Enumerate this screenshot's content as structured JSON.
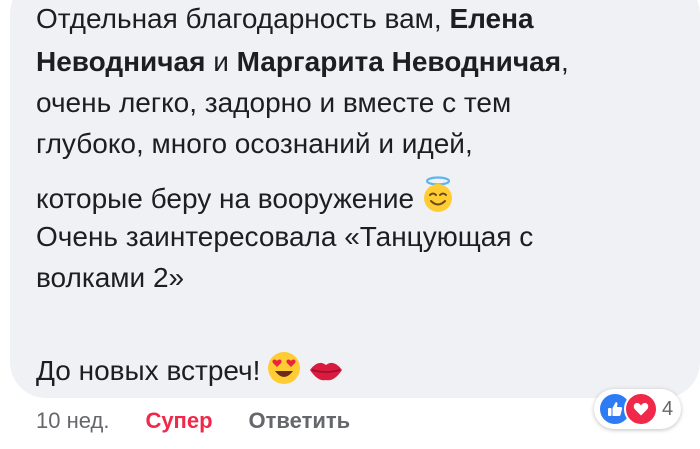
{
  "comment": {
    "line1": {
      "text": "Отдельная благодарность вам, ",
      "bold": "Елена"
    },
    "line2": {
      "bold1": "Неводничая",
      "mid": " и ",
      "bold2": "Маргарита Неводничая",
      "end": ","
    },
    "line3": "очень легко, задорно и вместе с тем",
    "line4": "глубоко, много осознаний и идей,",
    "line5": "которые беру на вооружение",
    "line6": "Очень заинтересовала «Танцующая с",
    "line7": "волками 2»",
    "line8": "До новых встреч!",
    "emojis": [
      "smiling-face-with-halo",
      "smiling-face-with-heart-eyes",
      "kiss-mark"
    ]
  },
  "footer": {
    "timestamp": "10 нед.",
    "like_label": "Супер",
    "reply_label": "Ответить"
  },
  "reactions": {
    "count": "4",
    "icons": [
      "like-icon",
      "love-icon"
    ]
  },
  "colors": {
    "bubble": "#f0f1f5",
    "text": "#1c1e21",
    "muted": "#65676b",
    "love": "#f0284a",
    "like": "#2d7cf6"
  }
}
